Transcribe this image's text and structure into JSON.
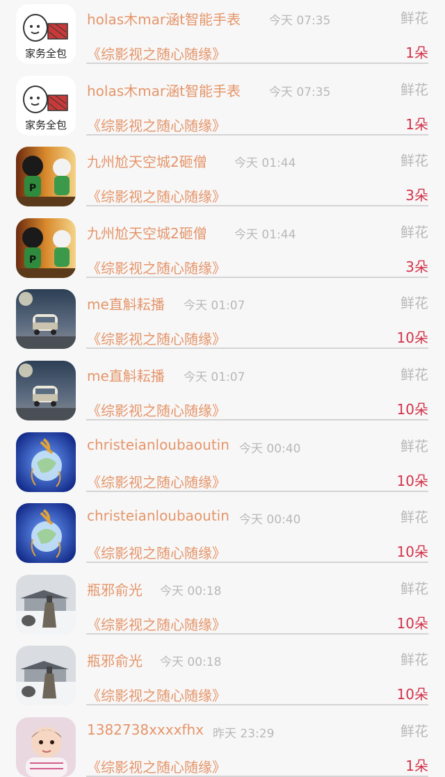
{
  "rows": [
    {
      "name": "holas木mar涵t智能手表",
      "time": "今天 07:35",
      "type": "鲜花",
      "work": "《综影视之随心随缘》",
      "count": "1朵",
      "avatar": "housework-avatar",
      "avatar_text": "家务全包"
    },
    {
      "name": "holas木mar涵t智能手表",
      "time": "今天 07:35",
      "type": "鲜花",
      "work": "《综影视之随心随缘》",
      "count": "1朵",
      "avatar": "housework-avatar",
      "avatar_text": "家务全包"
    },
    {
      "name": "九州尬天空城2砸僧",
      "time": "今天 01:44",
      "type": "鲜花",
      "work": "《综影视之随心随缘》",
      "count": "3朵",
      "avatar": "figurines-avatar",
      "avatar_text": "P"
    },
    {
      "name": "九州尬天空城2砸僧",
      "time": "今天 01:44",
      "type": "鲜花",
      "work": "《综影视之随心随缘》",
      "count": "3朵",
      "avatar": "figurines-avatar",
      "avatar_text": "P"
    },
    {
      "name": "me直斛耘播",
      "time": "今天 01:07",
      "type": "鲜花",
      "work": "《综影视之随心随缘》",
      "count": "10朵",
      "avatar": "van-avatar"
    },
    {
      "name": "me直斛耘播",
      "time": "今天 01:07",
      "type": "鲜花",
      "work": "《综影视之随心随缘》",
      "count": "10朵",
      "avatar": "van-avatar"
    },
    {
      "name": "christeianloubaoutin",
      "time": "今天 00:40",
      "type": "鲜花",
      "work": "《综影视之随心随缘》",
      "count": "10朵",
      "avatar": "globe-avatar"
    },
    {
      "name": "christeianloubaoutin",
      "time": "今天 00:40",
      "type": "鲜花",
      "work": "《综影视之随心随缘》",
      "count": "10朵",
      "avatar": "globe-avatar"
    },
    {
      "name": "瓶邪俞光",
      "time": "今天 00:18",
      "type": "鲜花",
      "work": "《综影视之随心随缘》",
      "count": "10朵",
      "avatar": "snow-palace-avatar"
    },
    {
      "name": "瓶邪俞光",
      "time": "今天 00:18",
      "type": "鲜花",
      "work": "《综影视之随心随缘》",
      "count": "10朵",
      "avatar": "snow-palace-avatar"
    },
    {
      "name": "1382738xxxxfhx",
      "time": "昨天 23:29",
      "type": "鲜花",
      "work": "《综影视之随心随缘》",
      "count": "1朵",
      "avatar": "baby-avatar"
    }
  ]
}
